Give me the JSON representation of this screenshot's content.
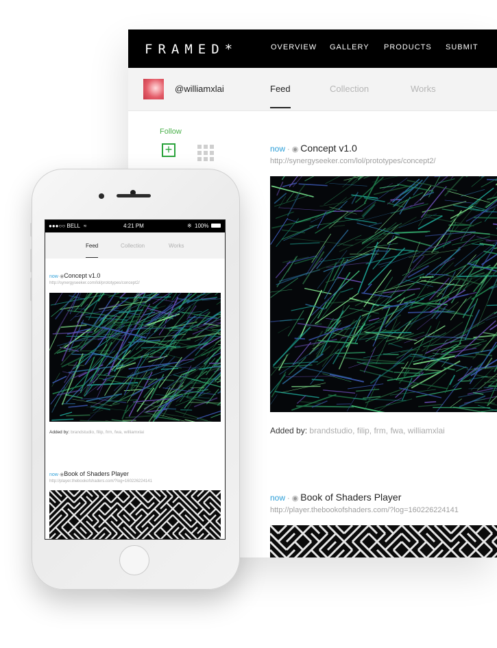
{
  "desktop": {
    "logo": "FRAMED*",
    "nav": [
      "OVERVIEW",
      "GALLERY",
      "PRODUCTS",
      "SUBMIT"
    ],
    "profile": {
      "handle": "@williamxlai"
    },
    "tabs": [
      "Feed",
      "Collection",
      "Works"
    ],
    "active_tab": "Feed",
    "follow_label": "Follow",
    "posts": [
      {
        "time": "now",
        "separator": "·",
        "title": "Concept v1.0",
        "url": "http://synergyseeker.com/lol/prototypes/concept2/",
        "added_label": "Added by:",
        "added_by": "brandstudio, filip, frm, fwa, williamxlai"
      },
      {
        "time": "now",
        "separator": "·",
        "title": "Book of Shaders Player",
        "url": "http://player.thebookofshaders.com/?log=160226224141"
      }
    ]
  },
  "phone": {
    "status": {
      "carrier": "●●●○○ BELL",
      "time": "4:21 PM",
      "battery": "100%"
    },
    "tabs": [
      "Feed",
      "Collection",
      "Works"
    ],
    "posts": [
      {
        "time": "now",
        "separator": "·",
        "title": "Concept v1.0",
        "url": "http://synergyseeker.com/lol/prototypes/concept2/",
        "added_label": "Added by:",
        "added_by": "brandstudio, filip, frm, fwa, williamxlai"
      },
      {
        "time": "now",
        "separator": "·",
        "title": "Book of Shaders Player",
        "url": "http://player.thebookofshaders.com/?log=160226224141"
      }
    ]
  },
  "icons": {
    "globe": "globe-icon",
    "wifi": "wifi-icon",
    "bluetooth": "bluetooth-icon",
    "battery": "battery-icon",
    "follow": "plus-square-icon",
    "grid": "grid-view-icon"
  },
  "colors": {
    "accent_blue": "#2d9fd8",
    "follow_green": "#2aa33b",
    "nav_bg": "#000000"
  }
}
